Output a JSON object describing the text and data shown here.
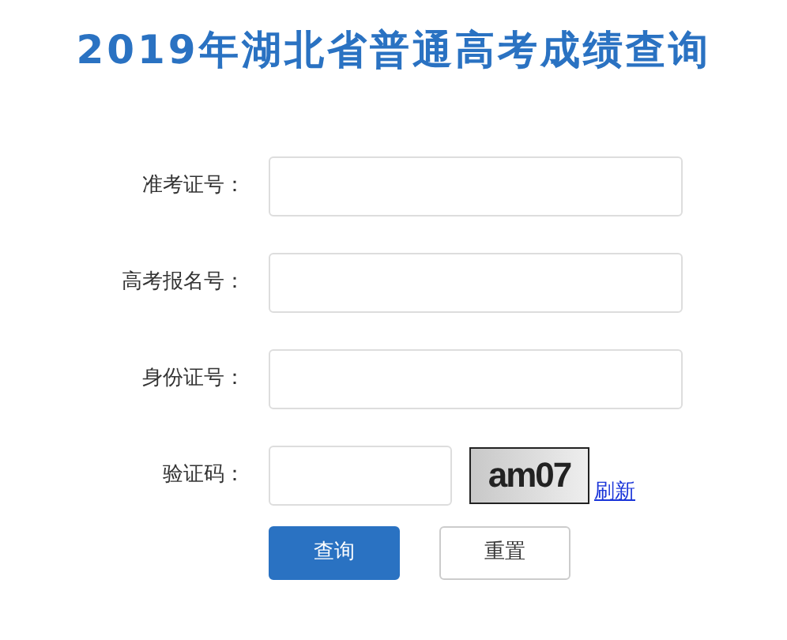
{
  "title": "2019年湖北省普通高考成绩查询",
  "fields": [
    {
      "label": "准考证号：",
      "kind": "text"
    },
    {
      "label": "高考报名号：",
      "kind": "text"
    },
    {
      "label": "身份证号：",
      "kind": "text"
    },
    {
      "label": "验证码：",
      "kind": "captcha",
      "captcha": "am07",
      "refresh": "刷新"
    }
  ],
  "buttons": [
    {
      "label": "查询",
      "kind": "primary"
    },
    {
      "label": "重置",
      "kind": "secondary"
    }
  ]
}
